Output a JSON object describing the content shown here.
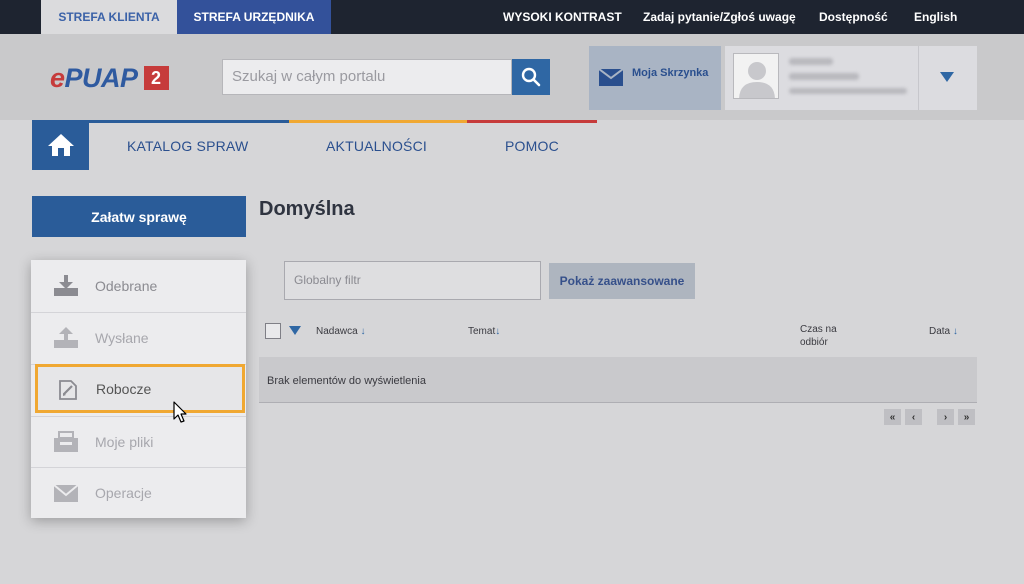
{
  "topbar": {
    "zone_client": "STREFA KLIENTA",
    "zone_official": "STREFA URZĘDNIKA",
    "high_contrast": "WYSOKI KONTRAST",
    "ask": "Zadaj pytanie/Zgłoś uwagę",
    "accessibility": "Dostępność",
    "english": "English"
  },
  "header": {
    "logo_e": "e",
    "logo_rest": "PUAP",
    "logo_badge": "2",
    "search_placeholder": "Szukaj w całym portalu",
    "inbox_label": "Moja Skrzynka",
    "search_icon": "search-icon",
    "dropdown_icon": "chevron-down-icon"
  },
  "nav": {
    "items": [
      "KATALOG SPRAW",
      "AKTUALNOŚCI",
      "POMOC"
    ],
    "stripe_colors": [
      "#2a5c99",
      "#f0a832",
      "#c63b3b"
    ]
  },
  "sidebar": {
    "primary_button": "Załatw sprawę",
    "items": [
      {
        "label": "Odebrane",
        "icon": "inbox-download-icon"
      },
      {
        "label": "Wysłane",
        "icon": "upload-icon"
      },
      {
        "label": "Robocze",
        "icon": "draft-edit-icon"
      },
      {
        "label": "Moje pliki",
        "icon": "files-icon"
      },
      {
        "label": "Operacje",
        "icon": "envelope-icon"
      }
    ],
    "highlight_color": "#f0a832"
  },
  "main": {
    "title": "Domyślna",
    "filter_placeholder": "Globalny filtr",
    "advanced_button": "Pokaż zaawansowane",
    "columns": {
      "sender": "Nadawca",
      "subject": "Temat",
      "time": "Czas na odbiór",
      "date": "Data"
    },
    "sort_arrow": "↓",
    "empty_message": "Brak elementów do wyświetlenia",
    "pager": [
      "«",
      "‹",
      "›",
      "»"
    ]
  },
  "colors": {
    "brand_blue": "#2a5c99",
    "accent_orange": "#f0a832",
    "brand_red": "#c63b3b"
  }
}
